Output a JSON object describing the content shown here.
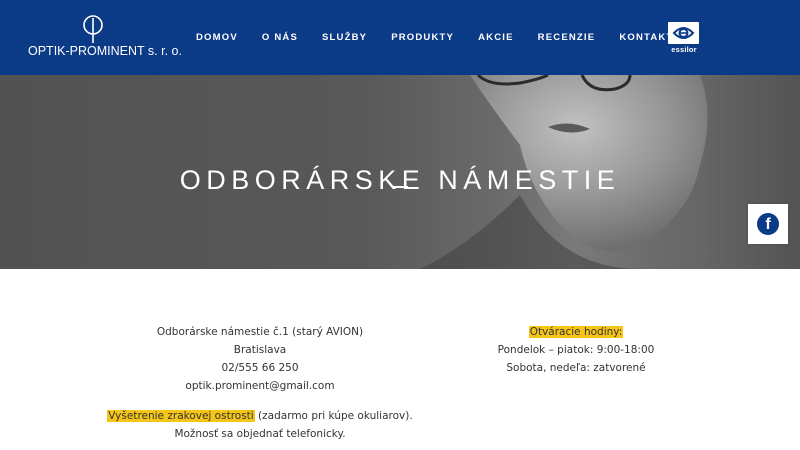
{
  "header": {
    "logo_text": "OPTIK-PROMINENT s. r. o.",
    "nav": [
      "DOMOV",
      "O NÁS",
      "SLUŽBY",
      "PRODUKTY",
      "AKCIE",
      "RECENZIE",
      "KONTAKT"
    ],
    "partner_text": "essilor",
    "bg_color": "#0b3a86"
  },
  "hero": {
    "title": "ODBORÁRSKE NÁMESTIE"
  },
  "social": {
    "icon": "facebook-icon",
    "glyph": "f"
  },
  "address": {
    "line1": "Odborárske námestie č.1 (starý AVION)",
    "city": "Bratislava",
    "phone": "02/555 66 250",
    "email": "optik.prominent@gmail.com"
  },
  "exam": {
    "highlight": "Vyšetrenie zrakovej ostrosti",
    "rest": " (zadarmo pri kúpe okuliarov).",
    "note": "Možnosť sa objednať telefonicky."
  },
  "hours": {
    "title": "Otváracie hodiny:",
    "weekdays": "Pondelok – piatok: 9:00-18:00",
    "weekend": "Sobota, nedeľa: zatvorené"
  },
  "colors": {
    "highlight": "#f5c518"
  }
}
